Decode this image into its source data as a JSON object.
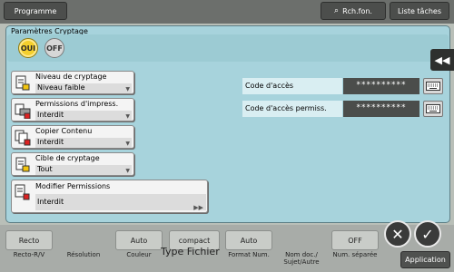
{
  "topbar": {
    "programme": "Programme",
    "search": "Rch.fon.",
    "tasks": "Liste tâches"
  },
  "function_bar": {
    "buttons": [
      "Recto",
      "Auto",
      "compact",
      "Auto",
      "OFF"
    ],
    "labels": [
      "Recto-R/V",
      "Résolution",
      "Couleur",
      "Format Num.",
      "Nom doc./ Sujet/Autre",
      "Num. séparée"
    ],
    "file_type": "Type Fichier",
    "application": "Application"
  },
  "dialog": {
    "title": "Paramètres Cryptage",
    "toggle_on": "OUI",
    "toggle_off": "OFF",
    "collapse_icon": "double-left-arrow-icon",
    "fields": [
      {
        "label": "Niveau de cryptage",
        "value": "Niveau faible",
        "icon": "encryption-level-icon"
      },
      {
        "label": "Permissions d'impress.",
        "value": "Interdit",
        "icon": "print-permission-icon"
      },
      {
        "label": "Copier Contenu",
        "value": "Interdit",
        "icon": "copy-content-icon"
      },
      {
        "label": "Cible de cryptage",
        "value": "Tout",
        "icon": "encryption-target-icon"
      }
    ],
    "modify": {
      "label": "Modifier Permissions",
      "value": "Interdit",
      "icon": "modify-permission-icon"
    },
    "codes": [
      {
        "label": "Code d'accès",
        "value": "**********"
      },
      {
        "label": "Code d'accès permiss.",
        "value": "**********"
      }
    ]
  },
  "actions": {
    "cancel": "✕",
    "ok": "✓"
  },
  "colors": {
    "dialog_bg": "#a7d3dc",
    "toggle_on": "#f4cf2d",
    "code_field": "#4b4d4b"
  }
}
